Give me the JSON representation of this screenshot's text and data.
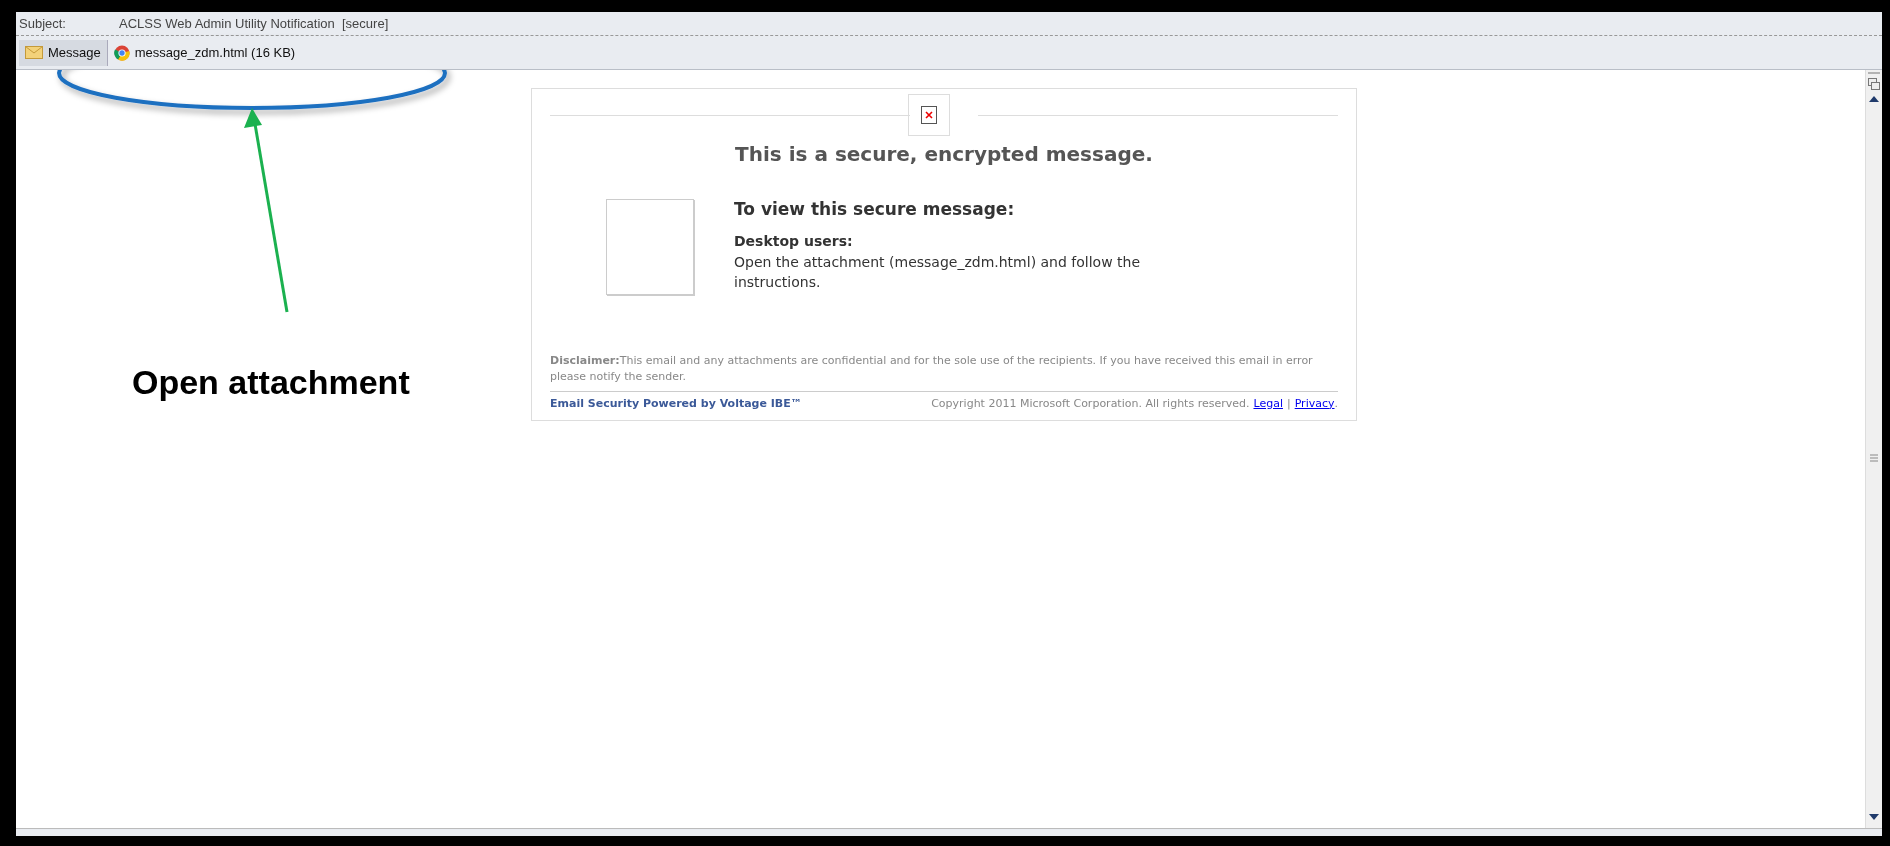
{
  "header": {
    "subject_label": "Subject:",
    "subject": "ACLSS Web Admin Utility Notification  [secure]"
  },
  "attachments": [
    {
      "kind": "message",
      "label": "Message",
      "selected": true
    },
    {
      "kind": "file",
      "label": "message_zdm.html (16 KB)",
      "selected": false
    }
  ],
  "message": {
    "title": "This is a secure, encrypted message.",
    "heading": "To view this secure message:",
    "subheading": "Desktop users:",
    "body": "Open the attachment (message_zdm.html) and follow the instructions.",
    "disclaimer": "**Disclaimer:**This email and any attachments are confidential and for the sole use of the recipients. If you have received this email in error please notify the sender.",
    "powered_by": "Email Security Powered by Voltage IBE™",
    "copyright": "Copyright 2011 Microsoft Corporation. All rights reserved.",
    "links": [
      "Legal",
      "Privacy"
    ],
    "separator": "|",
    "end": "."
  },
  "annotation": {
    "label": "Open attachment"
  }
}
